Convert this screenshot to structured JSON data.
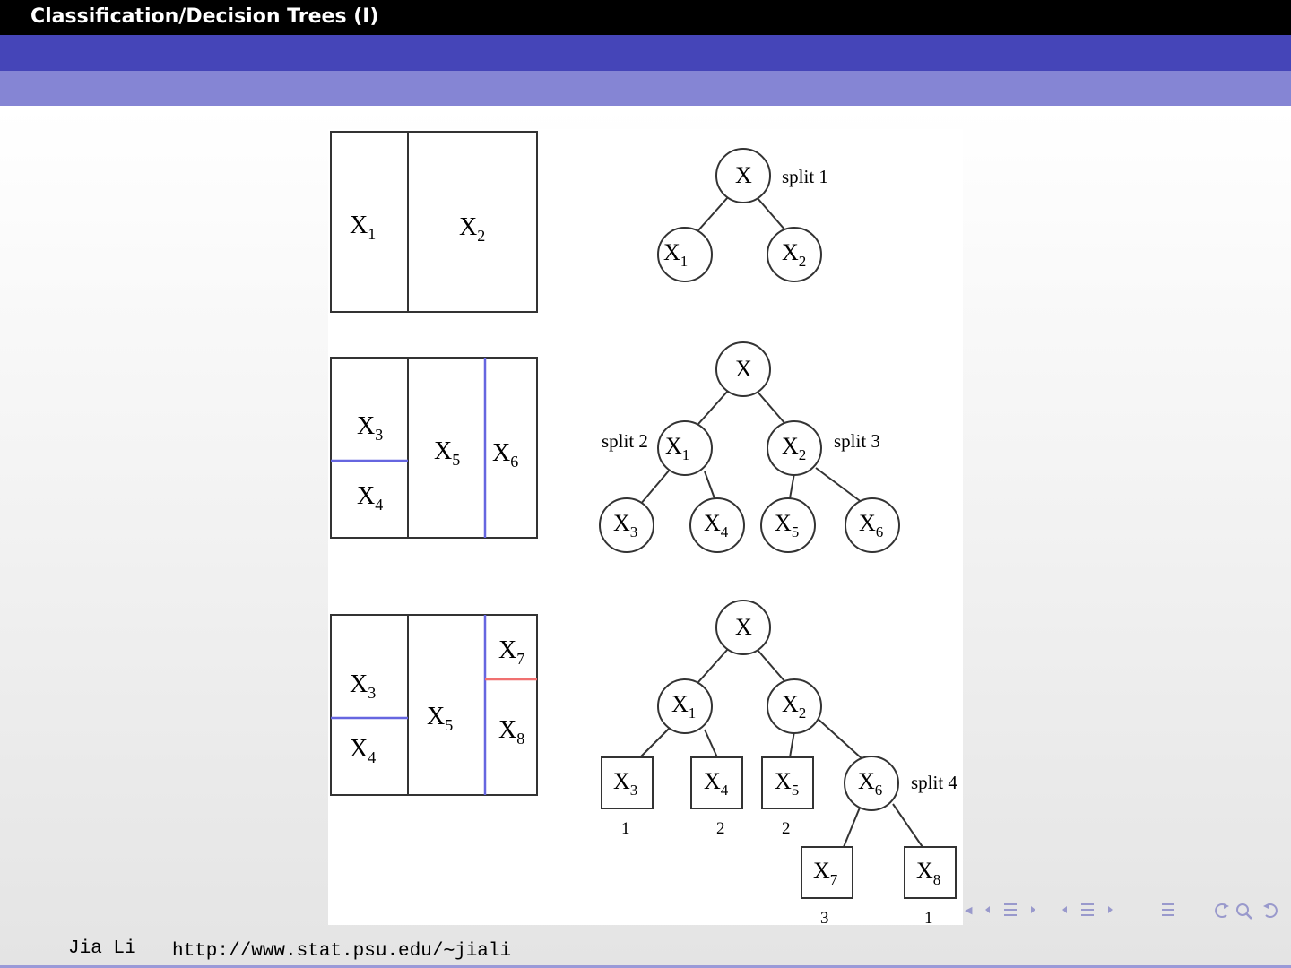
{
  "slide": {
    "title": "Classification/Decision Trees (I)"
  },
  "figure": {
    "panels": [
      {
        "regions": [
          {
            "name": "X",
            "sub": "1"
          },
          {
            "name": "X",
            "sub": "2"
          }
        ],
        "tree": {
          "nodes": [
            {
              "id": "root",
              "name": "X",
              "sub": ""
            },
            {
              "id": "n1",
              "name": "X",
              "sub": "1"
            },
            {
              "id": "n2",
              "name": "X",
              "sub": "2"
            }
          ],
          "annotations": [
            "split 1"
          ]
        }
      },
      {
        "regions": [
          {
            "name": "X",
            "sub": "3"
          },
          {
            "name": "X",
            "sub": "4"
          },
          {
            "name": "X",
            "sub": "5"
          },
          {
            "name": "X",
            "sub": "6"
          }
        ],
        "tree": {
          "nodes": [
            {
              "id": "root",
              "name": "X",
              "sub": ""
            },
            {
              "id": "n1",
              "name": "X",
              "sub": "1"
            },
            {
              "id": "n2",
              "name": "X",
              "sub": "2"
            },
            {
              "id": "n3",
              "name": "X",
              "sub": "3"
            },
            {
              "id": "n4",
              "name": "X",
              "sub": "4"
            },
            {
              "id": "n5",
              "name": "X",
              "sub": "5"
            },
            {
              "id": "n6",
              "name": "X",
              "sub": "6"
            }
          ],
          "annotations": [
            "split 2",
            "split 3"
          ]
        }
      },
      {
        "regions": [
          {
            "name": "X",
            "sub": "3"
          },
          {
            "name": "X",
            "sub": "4"
          },
          {
            "name": "X",
            "sub": "5"
          },
          {
            "name": "X",
            "sub": "7"
          },
          {
            "name": "X",
            "sub": "8"
          }
        ],
        "tree": {
          "nodes": [
            {
              "id": "root",
              "name": "X",
              "sub": ""
            },
            {
              "id": "n1",
              "name": "X",
              "sub": "1"
            },
            {
              "id": "n2",
              "name": "X",
              "sub": "2"
            },
            {
              "id": "n3",
              "name": "X",
              "sub": "3",
              "leaf_class": "1"
            },
            {
              "id": "n4",
              "name": "X",
              "sub": "4",
              "leaf_class": "2"
            },
            {
              "id": "n5",
              "name": "X",
              "sub": "5",
              "leaf_class": "2"
            },
            {
              "id": "n6",
              "name": "X",
              "sub": "6"
            },
            {
              "id": "n7",
              "name": "X",
              "sub": "7",
              "leaf_class": "3"
            },
            {
              "id": "n8",
              "name": "X",
              "sub": "8",
              "leaf_class": "1"
            }
          ],
          "annotations": [
            "split 4"
          ]
        }
      }
    ],
    "colors": {
      "split_blue": "#6666e0",
      "split_red": "#f07070",
      "lines": "#333333"
    }
  },
  "footer": {
    "author": "Jia Li",
    "url": "http://www.stat.psu.edu/∼jiali"
  },
  "nav_icons": [
    "prev-frame-icon",
    "next-frame-icon",
    "prev-section-icon",
    "section-icon",
    "next-section-icon",
    "prev-subsection-icon",
    "subsection-icon",
    "next-subsection-icon",
    "outline-icon",
    "back-icon",
    "search-icon",
    "forward-icon"
  ]
}
